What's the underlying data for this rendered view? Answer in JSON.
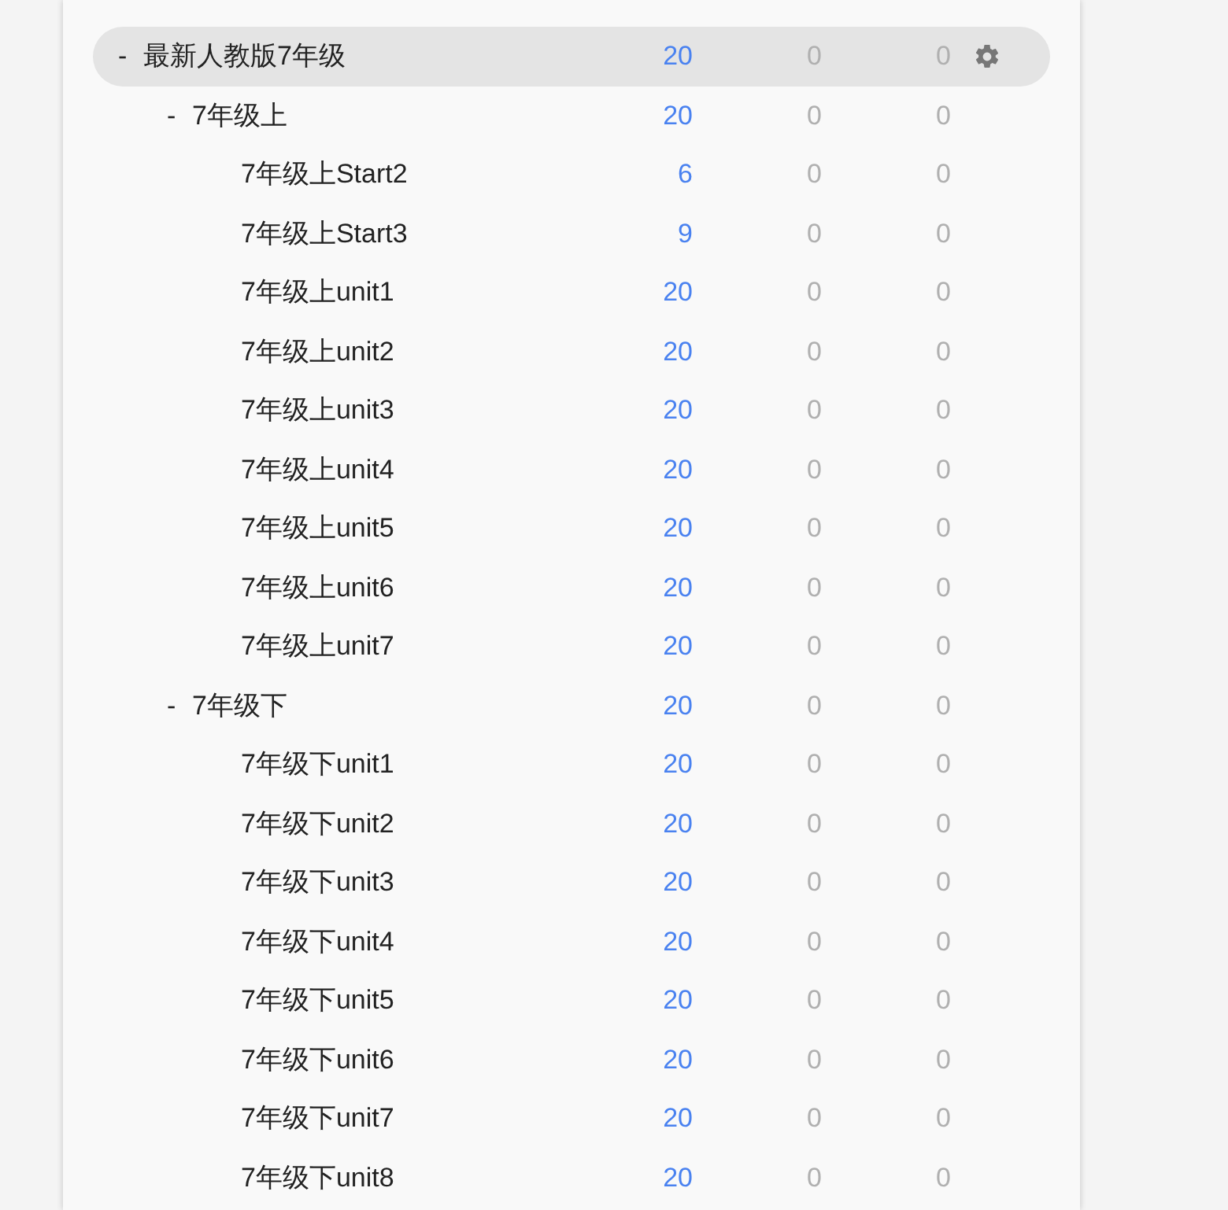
{
  "decks": [
    {
      "name": "最新人教版7年级",
      "toggle": "-",
      "selected": true,
      "counts": [
        {
          "text": "20",
          "muted": false
        },
        {
          "text": "0",
          "muted": true
        },
        {
          "text": "0",
          "muted": true
        }
      ],
      "children": [
        {
          "name": "7年级上",
          "toggle": "-",
          "selected": false,
          "counts": [
            {
              "text": "20",
              "muted": false
            },
            {
              "text": "0",
              "muted": true
            },
            {
              "text": "0",
              "muted": true
            }
          ],
          "children": [
            {
              "name": "7年级上Start2",
              "selected": false,
              "counts": [
                {
                  "text": "6",
                  "muted": false
                },
                {
                  "text": "0",
                  "muted": true
                },
                {
                  "text": "0",
                  "muted": true
                }
              ]
            },
            {
              "name": "7年级上Start3",
              "selected": false,
              "counts": [
                {
                  "text": "9",
                  "muted": false
                },
                {
                  "text": "0",
                  "muted": true
                },
                {
                  "text": "0",
                  "muted": true
                }
              ]
            },
            {
              "name": "7年级上unit1",
              "selected": false,
              "counts": [
                {
                  "text": "20",
                  "muted": false
                },
                {
                  "text": "0",
                  "muted": true
                },
                {
                  "text": "0",
                  "muted": true
                }
              ]
            },
            {
              "name": "7年级上unit2",
              "selected": false,
              "counts": [
                {
                  "text": "20",
                  "muted": false
                },
                {
                  "text": "0",
                  "muted": true
                },
                {
                  "text": "0",
                  "muted": true
                }
              ]
            },
            {
              "name": "7年级上unit3",
              "selected": false,
              "counts": [
                {
                  "text": "20",
                  "muted": false
                },
                {
                  "text": "0",
                  "muted": true
                },
                {
                  "text": "0",
                  "muted": true
                }
              ]
            },
            {
              "name": "7年级上unit4",
              "selected": false,
              "counts": [
                {
                  "text": "20",
                  "muted": false
                },
                {
                  "text": "0",
                  "muted": true
                },
                {
                  "text": "0",
                  "muted": true
                }
              ]
            },
            {
              "name": "7年级上unit5",
              "selected": false,
              "counts": [
                {
                  "text": "20",
                  "muted": false
                },
                {
                  "text": "0",
                  "muted": true
                },
                {
                  "text": "0",
                  "muted": true
                }
              ]
            },
            {
              "name": "7年级上unit6",
              "selected": false,
              "counts": [
                {
                  "text": "20",
                  "muted": false
                },
                {
                  "text": "0",
                  "muted": true
                },
                {
                  "text": "0",
                  "muted": true
                }
              ]
            },
            {
              "name": "7年级上unit7",
              "selected": false,
              "counts": [
                {
                  "text": "20",
                  "muted": false
                },
                {
                  "text": "0",
                  "muted": true
                },
                {
                  "text": "0",
                  "muted": true
                }
              ]
            }
          ]
        },
        {
          "name": "7年级下",
          "toggle": "-",
          "selected": false,
          "counts": [
            {
              "text": "20",
              "muted": false
            },
            {
              "text": "0",
              "muted": true
            },
            {
              "text": "0",
              "muted": true
            }
          ],
          "children": [
            {
              "name": "7年级下unit1",
              "selected": false,
              "counts": [
                {
                  "text": "20",
                  "muted": false
                },
                {
                  "text": "0",
                  "muted": true
                },
                {
                  "text": "0",
                  "muted": true
                }
              ]
            },
            {
              "name": "7年级下unit2",
              "selected": false,
              "counts": [
                {
                  "text": "20",
                  "muted": false
                },
                {
                  "text": "0",
                  "muted": true
                },
                {
                  "text": "0",
                  "muted": true
                }
              ]
            },
            {
              "name": "7年级下unit3",
              "selected": false,
              "counts": [
                {
                  "text": "20",
                  "muted": false
                },
                {
                  "text": "0",
                  "muted": true
                },
                {
                  "text": "0",
                  "muted": true
                }
              ]
            },
            {
              "name": "7年级下unit4",
              "selected": false,
              "counts": [
                {
                  "text": "20",
                  "muted": false
                },
                {
                  "text": "0",
                  "muted": true
                },
                {
                  "text": "0",
                  "muted": true
                }
              ]
            },
            {
              "name": "7年级下unit5",
              "selected": false,
              "counts": [
                {
                  "text": "20",
                  "muted": false
                },
                {
                  "text": "0",
                  "muted": true
                },
                {
                  "text": "0",
                  "muted": true
                }
              ]
            },
            {
              "name": "7年级下unit6",
              "selected": false,
              "counts": [
                {
                  "text": "20",
                  "muted": false
                },
                {
                  "text": "0",
                  "muted": true
                },
                {
                  "text": "0",
                  "muted": true
                }
              ]
            },
            {
              "name": "7年级下unit7",
              "selected": false,
              "counts": [
                {
                  "text": "20",
                  "muted": false
                },
                {
                  "text": "0",
                  "muted": true
                },
                {
                  "text": "0",
                  "muted": true
                }
              ]
            },
            {
              "name": "7年级下unit8",
              "selected": false,
              "counts": [
                {
                  "text": "20",
                  "muted": false
                },
                {
                  "text": "0",
                  "muted": true
                },
                {
                  "text": "0",
                  "muted": true
                }
              ]
            }
          ]
        }
      ]
    }
  ]
}
